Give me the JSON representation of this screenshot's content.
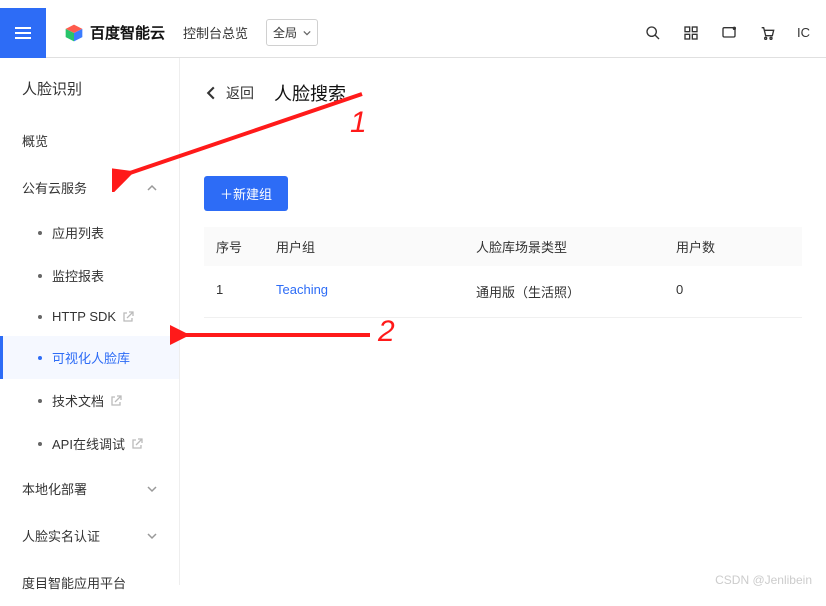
{
  "top": {
    "brand": "百度智能云",
    "console": "控制台总览",
    "global": "全局",
    "right_badge": "IC"
  },
  "sidebar": {
    "title": "人脸识别",
    "overview": "概览",
    "cloud_services": "公有云服务",
    "subs": [
      {
        "label": "应用列表",
        "link": false
      },
      {
        "label": "监控报表",
        "link": false
      },
      {
        "label": "HTTP SDK",
        "link": true
      },
      {
        "label": "可视化人脸库",
        "link": false,
        "active": true
      },
      {
        "label": "技术文档",
        "link": true
      },
      {
        "label": "API在线调试",
        "link": true
      }
    ],
    "local_deploy": "本地化部署",
    "realname": "人脸实名认证",
    "dumu": "度目智能应用平台"
  },
  "main": {
    "back": "返回",
    "title": "人脸搜索",
    "new_btn": "＋新建组",
    "cols": {
      "idx": "序号",
      "grp": "用户组",
      "scn": "人脸库场景类型",
      "cnt": "用户数"
    },
    "row": {
      "idx": "1",
      "grp": "Teaching",
      "scn": "通用版（生活照）",
      "cnt": "0"
    }
  },
  "annot": {
    "n1": "1",
    "n2": "2"
  },
  "watermark": "CSDN @Jenlibein"
}
